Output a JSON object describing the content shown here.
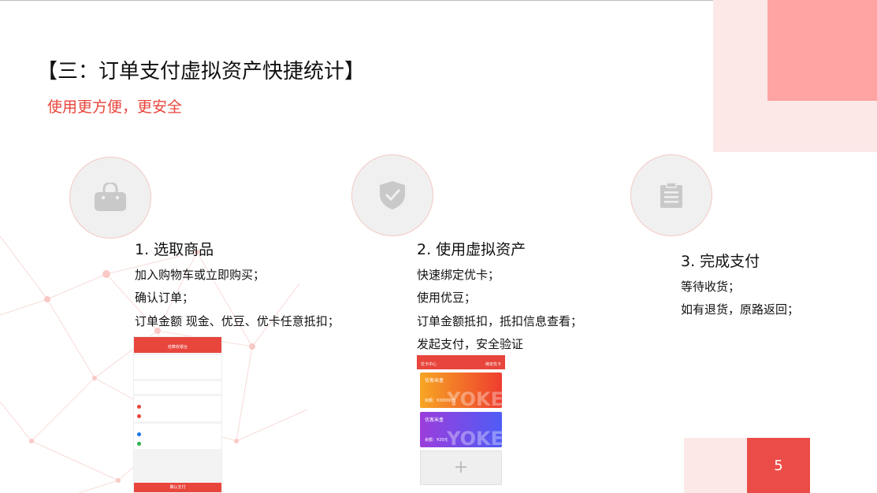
{
  "title": "【三：订单支付虚拟资产快捷统计】",
  "subtitle": "使用更方便，更安全",
  "steps": [
    {
      "title": "1. 选取商品",
      "lines": [
        "加入购物车或立即购买；",
        "确认订单；",
        "订单金额 现金、优豆、优卡任意抵扣；"
      ],
      "icon": "shopping-bag-icon"
    },
    {
      "title": "2. 使用虚拟资产",
      "lines": [
        "快速绑定优卡；",
        "使用优豆；",
        "订单金额抵扣，抵扣信息查看；",
        "发起支付，安全验证"
      ],
      "icon": "shield-check-icon"
    },
    {
      "title": "3. 完成支付",
      "lines": [
        "等待收货；",
        "如有退货，原路返回；"
      ],
      "icon": "clipboard-icon"
    }
  ],
  "mock1": {
    "header": "结算收银台",
    "confirm": "确认支付"
  },
  "mock2": {
    "header": "优卡中心",
    "header_right": "绑定优卡",
    "card1_name": "优客米盒",
    "card1_balance": "余额：¥20000元",
    "card2_name": "优客米盒",
    "card2_balance": "余额：¥20元",
    "watermark": "YOKE",
    "add": "+"
  },
  "page_number": "5",
  "colors": {
    "accent": "#e8453c",
    "deco_light": "#fde8e8",
    "deco_dark": "#ffa3a3"
  }
}
